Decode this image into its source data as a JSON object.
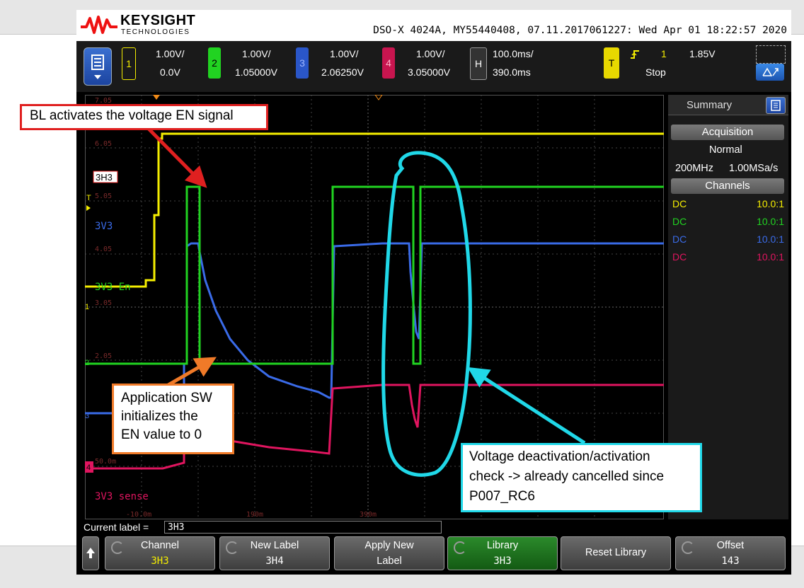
{
  "header": {
    "brand": "KEYSIGHT",
    "brand_sub": "TECHNOLOGIES",
    "status": "DSO-X 4024A, MY55440408, 07.11.2017061227: Wed Apr 01 18:22:57 2020"
  },
  "channels": [
    {
      "num": "1",
      "scale": "1.00V/",
      "offset": "0.0V",
      "color": "#f5ee00"
    },
    {
      "num": "2",
      "scale": "1.00V/",
      "offset": "1.05000V",
      "color": "#21d321"
    },
    {
      "num": "3",
      "scale": "1.00V/",
      "offset": "2.06250V",
      "color": "#3a6be8"
    },
    {
      "num": "4",
      "scale": "1.00V/",
      "offset": "3.05000V",
      "color": "#e0155f"
    }
  ],
  "horizontal": {
    "label": "H",
    "timebase": "100.0ms/",
    "delay": "390.0ms"
  },
  "trigger": {
    "label": "T",
    "slope_icon": "rising-edge",
    "source": "1",
    "level": "1.85V",
    "state": "Stop"
  },
  "waveform_labels": {
    "ch1": "3H3",
    "ch3": "3V3",
    "ch2": "3V3 En",
    "ch4": "3V3 sense",
    "trig_marker": "T",
    "gnd1": "1",
    "gnd2": "2",
    "gnd3": "3",
    "gnd4": "4"
  },
  "axis_ticks": {
    "x": [
      "-10.0m",
      "190m",
      "390m"
    ],
    "y": [
      "7.05",
      "6.05",
      "5.05",
      "4.05",
      "3.05",
      "2.05",
      "50.0m"
    ]
  },
  "summary_panel": {
    "title": "Summary",
    "acquisition_header": "Acquisition",
    "mode": "Normal",
    "bandwidth": "200MHz",
    "sample_rate": "1.00MSa/s",
    "channels_header": "Channels",
    "rows": [
      {
        "coupling": "DC",
        "probe": "10.0:1",
        "color": "#f5ee00"
      },
      {
        "coupling": "DC",
        "probe": "10.0:1",
        "color": "#21d321"
      },
      {
        "coupling": "DC",
        "probe": "10.0:1",
        "color": "#3a6be8"
      },
      {
        "coupling": "DC",
        "probe": "10.0:1",
        "color": "#e0155f"
      }
    ]
  },
  "current_label": {
    "prompt": "Current label =",
    "value": "3H3"
  },
  "softkeys": [
    {
      "line1": "Channel",
      "line2": "3H3"
    },
    {
      "line1": "New Label",
      "line2": "3H4"
    },
    {
      "line1": "Apply New",
      "line2": "Label"
    },
    {
      "line1": "Library",
      "line2": "3H3"
    },
    {
      "line1": "Reset Library",
      "line2": ""
    },
    {
      "line1": "Offset",
      "line2": "143"
    }
  ],
  "annotations": {
    "red": "BL activates the voltage EN signal",
    "orange": [
      "Application SW",
      "initializes the",
      "EN value to 0"
    ],
    "cyan": [
      "Voltage deactivation/activation",
      "check -> already cancelled since",
      "P007_RC6"
    ]
  },
  "colors": {
    "red": "#e02020",
    "orange": "#f07a28",
    "cyan": "#20d8e8"
  }
}
